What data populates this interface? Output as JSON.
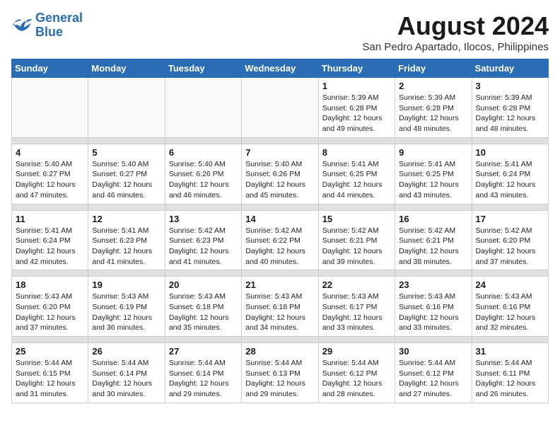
{
  "logo": {
    "line1": "General",
    "line2": "Blue"
  },
  "title": "August 2024",
  "subtitle": "San Pedro Apartado, Ilocos, Philippines",
  "headers": [
    "Sunday",
    "Monday",
    "Tuesday",
    "Wednesday",
    "Thursday",
    "Friday",
    "Saturday"
  ],
  "weeks": [
    [
      {
        "day": "",
        "info": ""
      },
      {
        "day": "",
        "info": ""
      },
      {
        "day": "",
        "info": ""
      },
      {
        "day": "",
        "info": ""
      },
      {
        "day": "1",
        "info": "Sunrise: 5:39 AM\nSunset: 6:28 PM\nDaylight: 12 hours\nand 49 minutes."
      },
      {
        "day": "2",
        "info": "Sunrise: 5:39 AM\nSunset: 6:28 PM\nDaylight: 12 hours\nand 48 minutes."
      },
      {
        "day": "3",
        "info": "Sunrise: 5:39 AM\nSunset: 6:28 PM\nDaylight: 12 hours\nand 48 minutes."
      }
    ],
    [
      {
        "day": "4",
        "info": "Sunrise: 5:40 AM\nSunset: 6:27 PM\nDaylight: 12 hours\nand 47 minutes."
      },
      {
        "day": "5",
        "info": "Sunrise: 5:40 AM\nSunset: 6:27 PM\nDaylight: 12 hours\nand 46 minutes."
      },
      {
        "day": "6",
        "info": "Sunrise: 5:40 AM\nSunset: 6:26 PM\nDaylight: 12 hours\nand 46 minutes."
      },
      {
        "day": "7",
        "info": "Sunrise: 5:40 AM\nSunset: 6:26 PM\nDaylight: 12 hours\nand 45 minutes."
      },
      {
        "day": "8",
        "info": "Sunrise: 5:41 AM\nSunset: 6:25 PM\nDaylight: 12 hours\nand 44 minutes."
      },
      {
        "day": "9",
        "info": "Sunrise: 5:41 AM\nSunset: 6:25 PM\nDaylight: 12 hours\nand 43 minutes."
      },
      {
        "day": "10",
        "info": "Sunrise: 5:41 AM\nSunset: 6:24 PM\nDaylight: 12 hours\nand 43 minutes."
      }
    ],
    [
      {
        "day": "11",
        "info": "Sunrise: 5:41 AM\nSunset: 6:24 PM\nDaylight: 12 hours\nand 42 minutes."
      },
      {
        "day": "12",
        "info": "Sunrise: 5:41 AM\nSunset: 6:23 PM\nDaylight: 12 hours\nand 41 minutes."
      },
      {
        "day": "13",
        "info": "Sunrise: 5:42 AM\nSunset: 6:23 PM\nDaylight: 12 hours\nand 41 minutes."
      },
      {
        "day": "14",
        "info": "Sunrise: 5:42 AM\nSunset: 6:22 PM\nDaylight: 12 hours\nand 40 minutes."
      },
      {
        "day": "15",
        "info": "Sunrise: 5:42 AM\nSunset: 6:21 PM\nDaylight: 12 hours\nand 39 minutes."
      },
      {
        "day": "16",
        "info": "Sunrise: 5:42 AM\nSunset: 6:21 PM\nDaylight: 12 hours\nand 38 minutes."
      },
      {
        "day": "17",
        "info": "Sunrise: 5:42 AM\nSunset: 6:20 PM\nDaylight: 12 hours\nand 37 minutes."
      }
    ],
    [
      {
        "day": "18",
        "info": "Sunrise: 5:43 AM\nSunset: 6:20 PM\nDaylight: 12 hours\nand 37 minutes."
      },
      {
        "day": "19",
        "info": "Sunrise: 5:43 AM\nSunset: 6:19 PM\nDaylight: 12 hours\nand 36 minutes."
      },
      {
        "day": "20",
        "info": "Sunrise: 5:43 AM\nSunset: 6:18 PM\nDaylight: 12 hours\nand 35 minutes."
      },
      {
        "day": "21",
        "info": "Sunrise: 5:43 AM\nSunset: 6:18 PM\nDaylight: 12 hours\nand 34 minutes."
      },
      {
        "day": "22",
        "info": "Sunrise: 5:43 AM\nSunset: 6:17 PM\nDaylight: 12 hours\nand 33 minutes."
      },
      {
        "day": "23",
        "info": "Sunrise: 5:43 AM\nSunset: 6:16 PM\nDaylight: 12 hours\nand 33 minutes."
      },
      {
        "day": "24",
        "info": "Sunrise: 5:43 AM\nSunset: 6:16 PM\nDaylight: 12 hours\nand 32 minutes."
      }
    ],
    [
      {
        "day": "25",
        "info": "Sunrise: 5:44 AM\nSunset: 6:15 PM\nDaylight: 12 hours\nand 31 minutes."
      },
      {
        "day": "26",
        "info": "Sunrise: 5:44 AM\nSunset: 6:14 PM\nDaylight: 12 hours\nand 30 minutes."
      },
      {
        "day": "27",
        "info": "Sunrise: 5:44 AM\nSunset: 6:14 PM\nDaylight: 12 hours\nand 29 minutes."
      },
      {
        "day": "28",
        "info": "Sunrise: 5:44 AM\nSunset: 6:13 PM\nDaylight: 12 hours\nand 29 minutes."
      },
      {
        "day": "29",
        "info": "Sunrise: 5:44 AM\nSunset: 6:12 PM\nDaylight: 12 hours\nand 28 minutes."
      },
      {
        "day": "30",
        "info": "Sunrise: 5:44 AM\nSunset: 6:12 PM\nDaylight: 12 hours\nand 27 minutes."
      },
      {
        "day": "31",
        "info": "Sunrise: 5:44 AM\nSunset: 6:11 PM\nDaylight: 12 hours\nand 26 minutes."
      }
    ]
  ]
}
